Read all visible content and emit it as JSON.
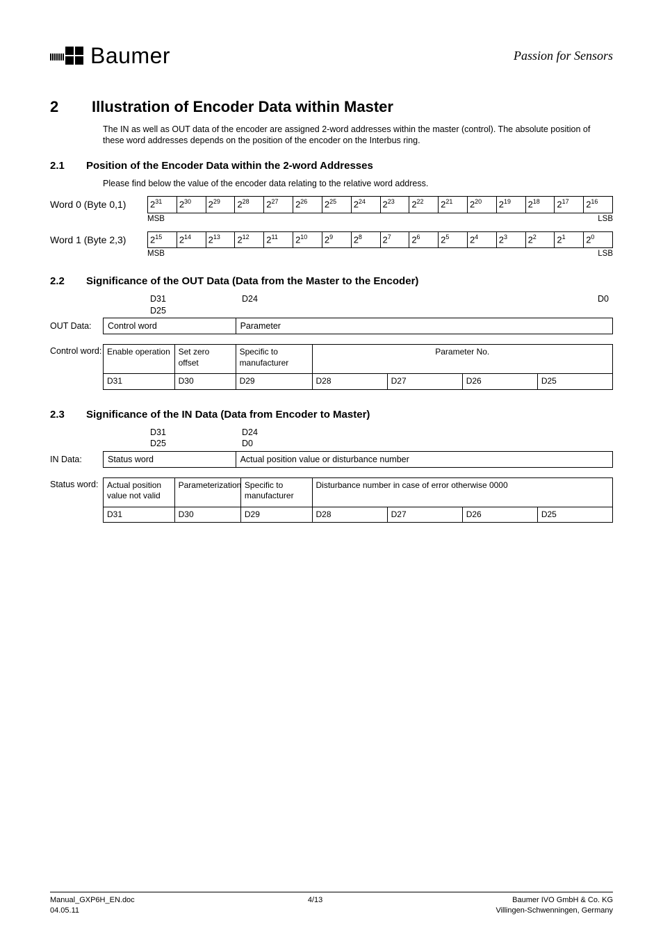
{
  "header": {
    "logo_text": "Baumer",
    "tagline": "Passion for Sensors"
  },
  "section2": {
    "num": "2",
    "title": "Illustration of Encoder Data within Master",
    "intro": "The IN as well as OUT data of the encoder are assigned 2-word addresses within the master (control). The absolute position of these word addresses depends on the position of the encoder on the Interbus ring."
  },
  "section2_1": {
    "num": "2.1",
    "title": "Position of the Encoder Data within the 2-word Addresses",
    "intro": "Please find below the value of the encoder data relating to the relative word address.",
    "word0_label": "Word 0  (Byte 0,1)",
    "word1_label": "Word 1  (Byte 2,3)",
    "msb": "MSB",
    "lsb": "LSB",
    "word0_bits": [
      "31",
      "30",
      "29",
      "28",
      "27",
      "26",
      "25",
      "24",
      "23",
      "22",
      "21",
      "20",
      "19",
      "18",
      "17",
      "16"
    ],
    "word1_bits": [
      "15",
      "14",
      "13",
      "12",
      "11",
      "10",
      "9",
      "8",
      "7",
      "6",
      "5",
      "4",
      "3",
      "2",
      "1",
      "0"
    ]
  },
  "section2_2": {
    "num": "2.2",
    "title": "Significance of the OUT Data (Data from the Master to the Encoder)",
    "d31": "D31",
    "d25": "D25",
    "d24": "D24",
    "d0": "D0",
    "out_label": "OUT Data:",
    "out_cells": [
      "Control word",
      "Parameter"
    ],
    "ctrl_label": "Control word:",
    "ctrl_row1": [
      "Enable operation",
      "Set zero offset",
      "Specific to manufacturer",
      "Parameter No."
    ],
    "ctrl_row2": [
      "D31",
      "D30",
      "D29",
      "D28",
      "D27",
      "D26",
      "D25"
    ]
  },
  "section2_3": {
    "num": "2.3",
    "title": "Significance of the IN Data (Data from Encoder to Master)",
    "d31": "D31",
    "d25": "D25",
    "d24": "D24",
    "d0": "D0",
    "in_label": "IN Data:",
    "in_cells": [
      "Status word",
      "Actual position value or disturbance number"
    ],
    "status_label": "Status word:",
    "status_row1": [
      "Actual position value not valid",
      "Parameterization",
      "Specific to manufacturer",
      "Disturbance number in case of error otherwise 0000"
    ],
    "status_row2": [
      "D31",
      "D30",
      "D29",
      "D28",
      "D27",
      "D26",
      "D25"
    ]
  },
  "footer": {
    "left1": "Manual_GXP6H_EN.doc",
    "left2": "04.05.11",
    "mid": "4/13",
    "right1": "Baumer IVO GmbH & Co. KG",
    "right2": "Villingen-Schwenningen, Germany"
  }
}
